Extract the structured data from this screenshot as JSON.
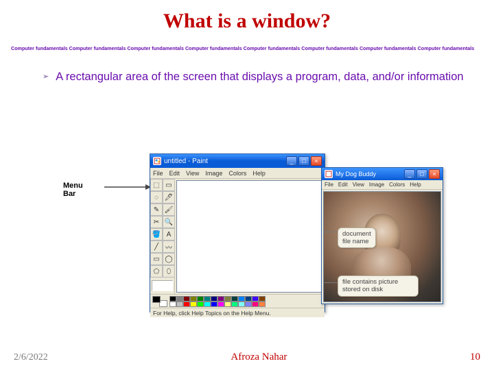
{
  "title": "What is a window?",
  "repeat_unit": "Computer fundamentals",
  "bullet_text": "A rectangular area of the screen that displays a program, data, and/or information",
  "diagram": {
    "menu_bar_label": "Menu Bar",
    "paint": {
      "title": "untitled - Paint",
      "menus": [
        "File",
        "Edit",
        "View",
        "Image",
        "Colors",
        "Help"
      ],
      "status": "For Help, click Help Topics on the Help Menu."
    },
    "dog": {
      "title": "My Dog Buddy",
      "menus": [
        "File",
        "Edit",
        "View",
        "Image",
        "Colors",
        "Help"
      ]
    },
    "callouts": {
      "c1": "document file name",
      "c2": "file contains picture stored on disk"
    }
  },
  "palette_row1": [
    "#000000",
    "#808080",
    "#800000",
    "#808000",
    "#008000",
    "#008080",
    "#000080",
    "#800080",
    "#808040",
    "#004040",
    "#0080ff",
    "#004080",
    "#4000ff",
    "#804000"
  ],
  "palette_row2": [
    "#ffffff",
    "#c0c0c0",
    "#ff0000",
    "#ffff00",
    "#00ff00",
    "#00ffff",
    "#0000ff",
    "#ff00ff",
    "#ffff80",
    "#00ff80",
    "#80ffff",
    "#8080ff",
    "#ff0080",
    "#ff8040"
  ],
  "footer": {
    "date": "2/6/2022",
    "author": "Afroza Nahar",
    "page": "10"
  }
}
